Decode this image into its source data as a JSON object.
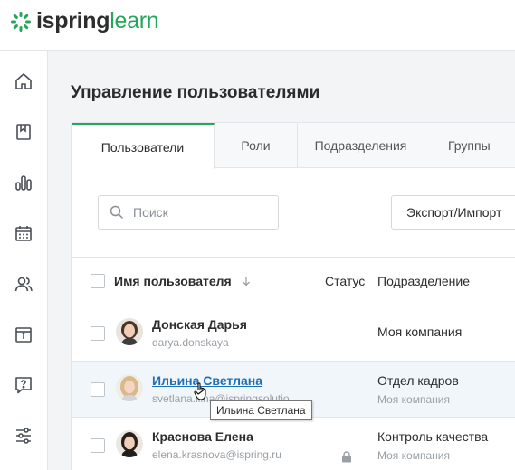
{
  "app": {
    "logo_part1": "ispring",
    "logo_part2": "learn",
    "brand_color": "#26a65b"
  },
  "sidebar": {
    "items": [
      {
        "icon": "home-icon"
      },
      {
        "icon": "book-icon"
      },
      {
        "icon": "bar-chart-icon"
      },
      {
        "icon": "calendar-icon"
      },
      {
        "icon": "users-icon"
      },
      {
        "icon": "info-box-icon"
      },
      {
        "icon": "question-chat-icon"
      },
      {
        "icon": "sliders-icon"
      }
    ]
  },
  "page": {
    "title": "Управление пользователями"
  },
  "tabs": [
    {
      "label": "Пользователи",
      "active": true
    },
    {
      "label": "Роли"
    },
    {
      "label": "Подразделения"
    },
    {
      "label": "Группы"
    }
  ],
  "toolbar": {
    "search_placeholder": "Поиск",
    "export_label": "Экспорт/Импорт"
  },
  "table": {
    "columns": {
      "name": "Имя пользователя",
      "status": "Статус",
      "department": "Подразделение"
    },
    "rows": [
      {
        "name": "Донская Дарья",
        "email": "darya.donskaya",
        "department": "Моя компания",
        "department_sub": ""
      },
      {
        "name": "Ильина Светлана",
        "email": "svetlana.ilina@ispringsolutio",
        "department": "Отдел кадров",
        "department_sub": "Моя компания"
      },
      {
        "name": "Краснова Елена",
        "email": "elena.krasnova@ispring.ru",
        "department": "Контроль качества",
        "department_sub": "Моя компания"
      }
    ]
  },
  "tooltip": {
    "text": "Ильина Светлана"
  }
}
